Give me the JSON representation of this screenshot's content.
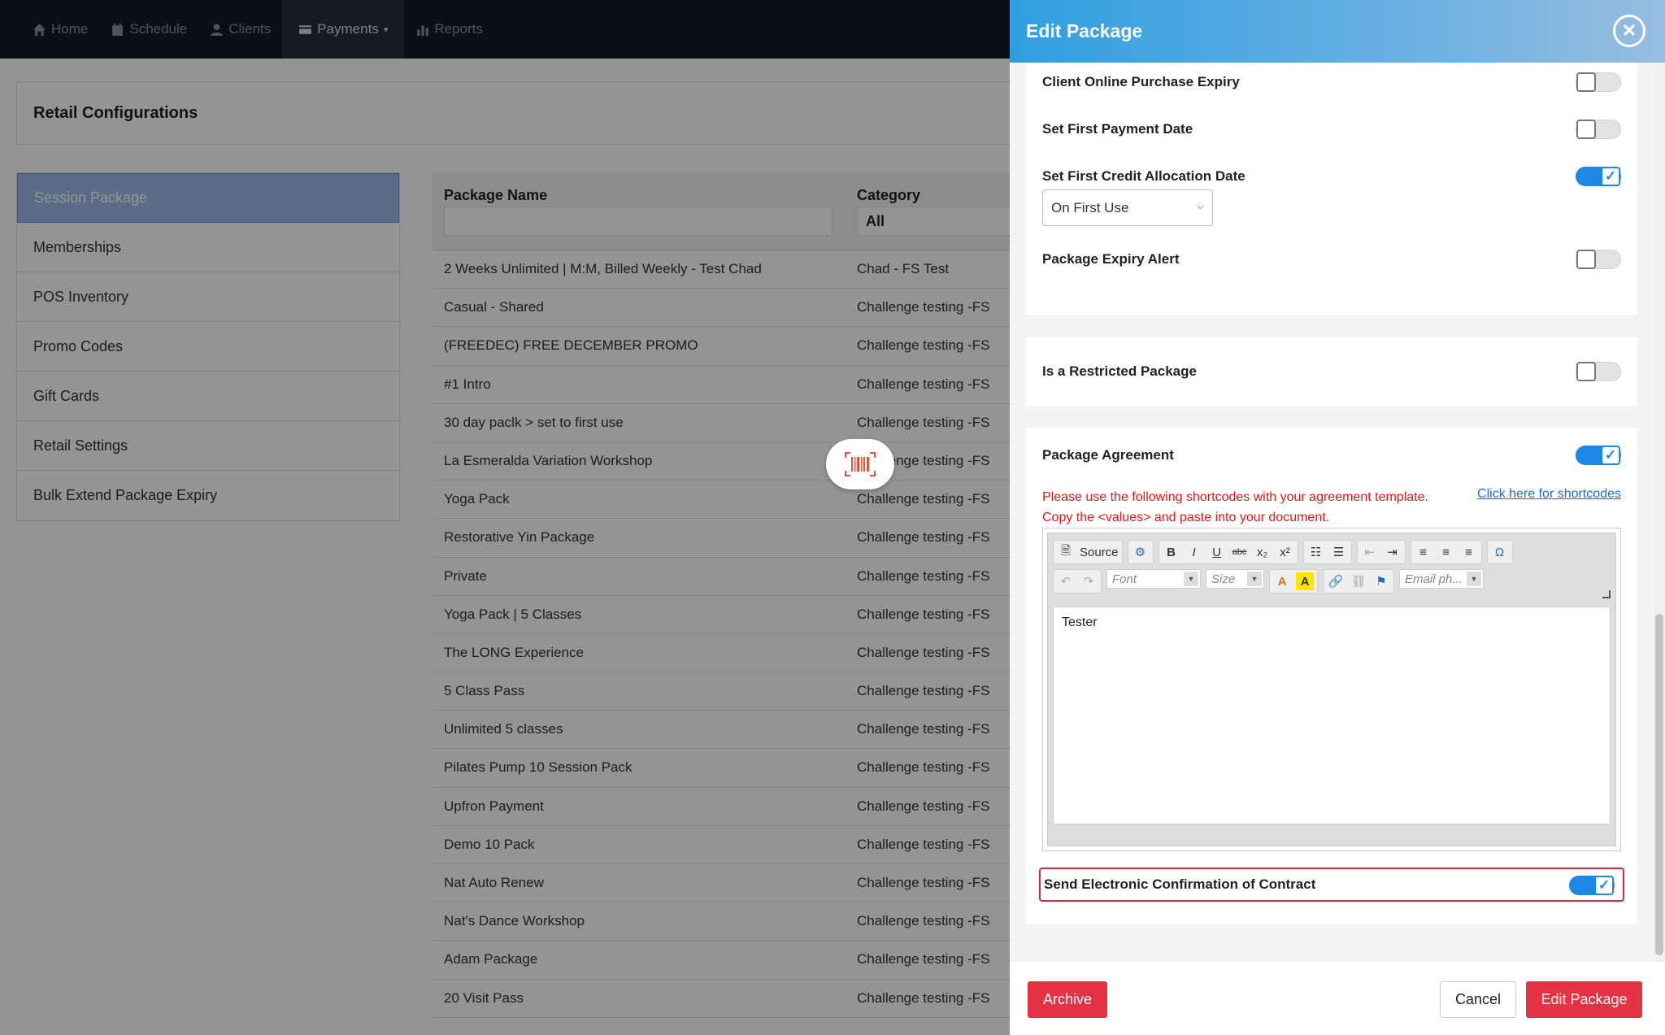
{
  "nav": {
    "items": [
      {
        "label": "Home",
        "icon": "home-icon"
      },
      {
        "label": "Schedule",
        "icon": "calendar-icon"
      },
      {
        "label": "Clients",
        "icon": "user-icon"
      },
      {
        "label": "Payments",
        "icon": "credit-card-icon"
      },
      {
        "label": "Reports",
        "icon": "bar-chart-icon"
      }
    ]
  },
  "page": {
    "title": "Retail Configurations"
  },
  "sidebar": {
    "items": [
      {
        "label": "Session Package"
      },
      {
        "label": "Memberships"
      },
      {
        "label": "POS Inventory"
      },
      {
        "label": "Promo Codes"
      },
      {
        "label": "Gift Cards"
      },
      {
        "label": "Retail Settings"
      },
      {
        "label": "Bulk Extend Package Expiry"
      }
    ]
  },
  "table": {
    "col_name": "Package Name",
    "col_category": "Category",
    "category_filter_value": "All",
    "rows": [
      {
        "name": "2 Weeks Unlimited | M:M, Billed Weekly - Test Chad",
        "category": "Chad - FS Test"
      },
      {
        "name": "Casual - Shared",
        "category": "Challenge testing -FS"
      },
      {
        "name": "(FREEDEC) FREE DECEMBER PROMO",
        "category": "Challenge testing -FS"
      },
      {
        "name": "#1 Intro",
        "category": "Challenge testing -FS"
      },
      {
        "name": "30 day paclk > set to first use",
        "category": "Challenge testing -FS"
      },
      {
        "name": "La Esmeralda Variation Workshop",
        "category": "Challenge testing -FS"
      },
      {
        "name": "Yoga Pack",
        "category": "Challenge testing -FS"
      },
      {
        "name": "Restorative Yin Package",
        "category": "Challenge testing -FS"
      },
      {
        "name": "Private",
        "category": "Challenge testing -FS"
      },
      {
        "name": "Yoga Pack | 5 Classes",
        "category": "Challenge testing -FS"
      },
      {
        "name": "The LONG Experience",
        "category": "Challenge testing -FS"
      },
      {
        "name": "5 Class Pass",
        "category": "Challenge testing -FS"
      },
      {
        "name": "Unlimited 5 classes",
        "category": "Challenge testing -FS"
      },
      {
        "name": "Pilates Pump 10 Session Pack",
        "category": "Challenge testing -FS"
      },
      {
        "name": "Upfron Payment",
        "category": "Challenge testing -FS"
      },
      {
        "name": "Demo 10 Pack",
        "category": "Challenge testing -FS"
      },
      {
        "name": "Nat Auto Renew",
        "category": "Challenge testing -FS"
      },
      {
        "name": "Nat's Dance Workshop",
        "category": "Challenge testing -FS"
      },
      {
        "name": "Adam Package",
        "category": "Challenge testing -FS"
      },
      {
        "name": "20 Visit Pass",
        "category": "Challenge testing -FS"
      }
    ]
  },
  "panel": {
    "title": "Edit Package",
    "settings": {
      "online_expiry": {
        "label": "Client Online Purchase Expiry",
        "on": false
      },
      "first_payment": {
        "label": "Set First Payment Date",
        "on": false
      },
      "first_credit": {
        "label": "Set First Credit Allocation Date",
        "on": true,
        "select_value": "On First Use"
      },
      "expiry_alert": {
        "label": "Package Expiry Alert",
        "on": false
      },
      "restricted": {
        "label": "Is a Restricted Package",
        "on": false
      },
      "agreement": {
        "label": "Package Agreement",
        "on": true
      },
      "send_confirmation": {
        "label": "Send Electronic Confirmation of Contract",
        "on": true
      }
    },
    "agreement_note": "Please use the following shortcodes with your agreement template. Copy the <values> and paste into your document.",
    "shortcodes_link": "Click here for shortcodes",
    "editor": {
      "source_label": "Source",
      "font_placeholder": "Font",
      "size_placeholder": "Size",
      "email_placeholder": "Email ph...",
      "content": "Tester"
    },
    "footer": {
      "archive": "Archive",
      "cancel": "Cancel",
      "submit": "Edit Package"
    }
  },
  "colors": {
    "accent": "#1e88e5",
    "danger": "#e53346",
    "nav_bg": "#141a2b"
  }
}
